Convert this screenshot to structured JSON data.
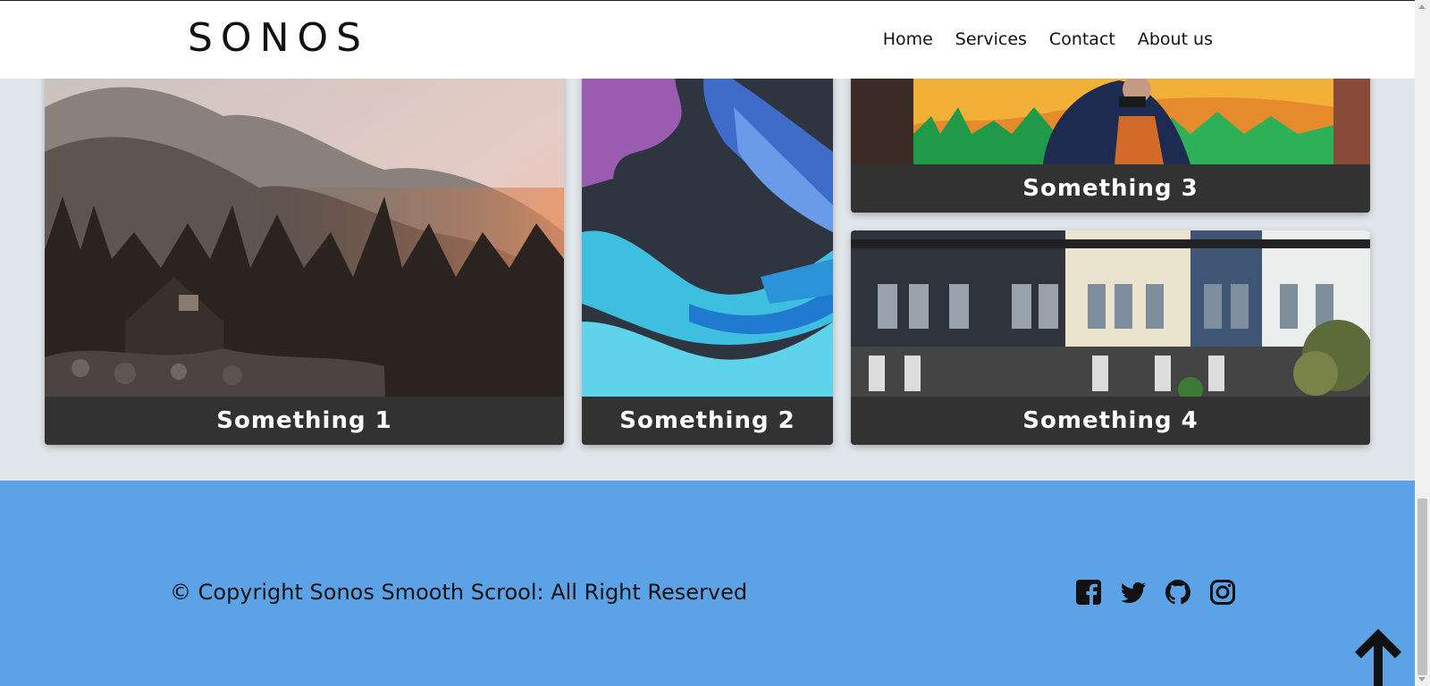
{
  "header": {
    "logo": "SONOS",
    "nav": [
      {
        "label": "Home"
      },
      {
        "label": "Services"
      },
      {
        "label": "Contact"
      },
      {
        "label": "About us"
      }
    ]
  },
  "gallery": {
    "cards": [
      {
        "caption": "Something 1",
        "image": "mountain-forest-sunset"
      },
      {
        "caption": "Something 2",
        "image": "abstract-graffiti"
      },
      {
        "caption": "Something 3",
        "image": "street-mural"
      },
      {
        "caption": "Something 4",
        "image": "victorian-houses"
      }
    ]
  },
  "footer": {
    "copyright": "© Copyright Sonos Smooth Scrool: All Right Reserved",
    "socials": [
      "facebook-icon",
      "twitter-icon",
      "github-icon",
      "instagram-icon"
    ],
    "background": "#5ba3e6"
  },
  "colors": {
    "page_background": "#e1e6ea",
    "caption_background": "#323232",
    "footer_background": "#5ba3e6"
  }
}
